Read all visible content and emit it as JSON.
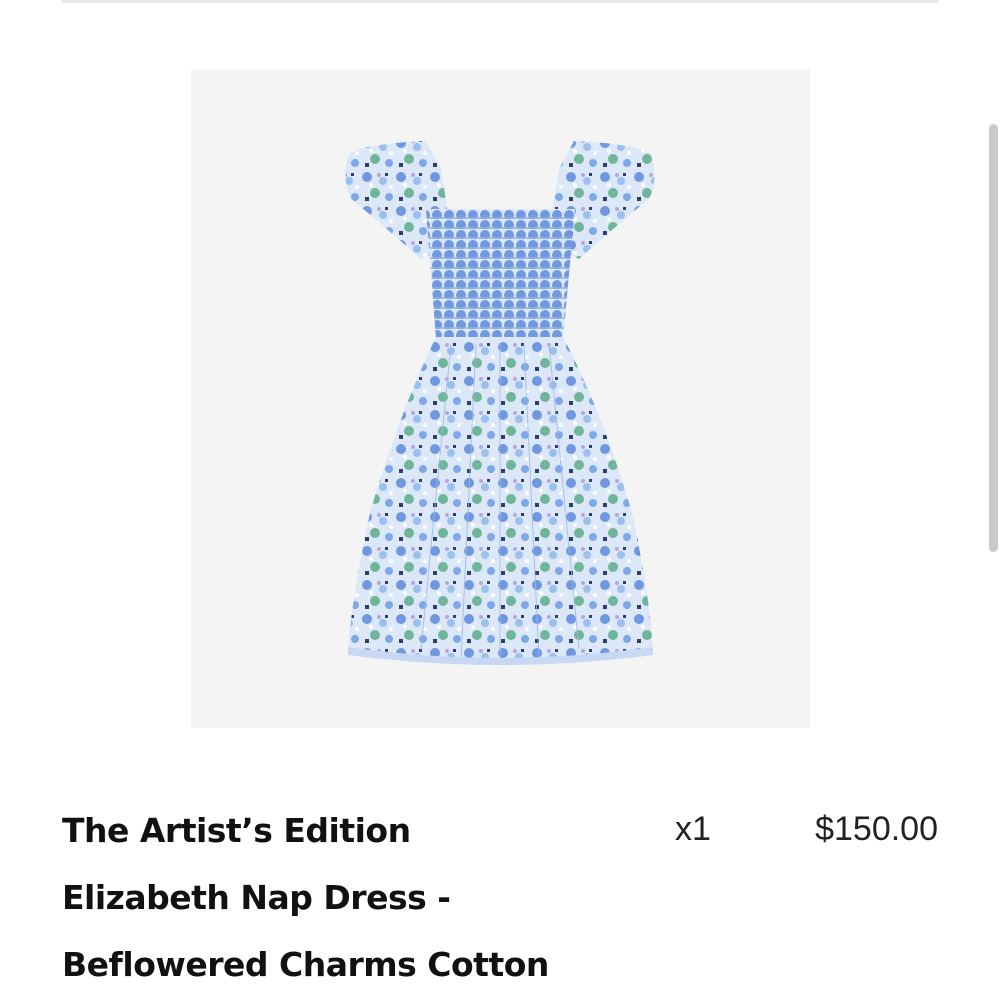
{
  "product": {
    "image_alt": "Floral smocked nap dress",
    "title_lines": [
      "The Artist’s Edition",
      "Elizabeth Nap Dress -",
      "Beflowered Charms Cotton"
    ],
    "quantity": "x1",
    "price": "$150.00"
  },
  "colors": {
    "image_background": "#f4f4f5",
    "dress_base": "#a9c6ee",
    "dress_light": "#e4ecf8",
    "flower_blue": "#6f98e0",
    "flower_green": "#6fb59a",
    "flower_navy": "#2f3f6b"
  }
}
